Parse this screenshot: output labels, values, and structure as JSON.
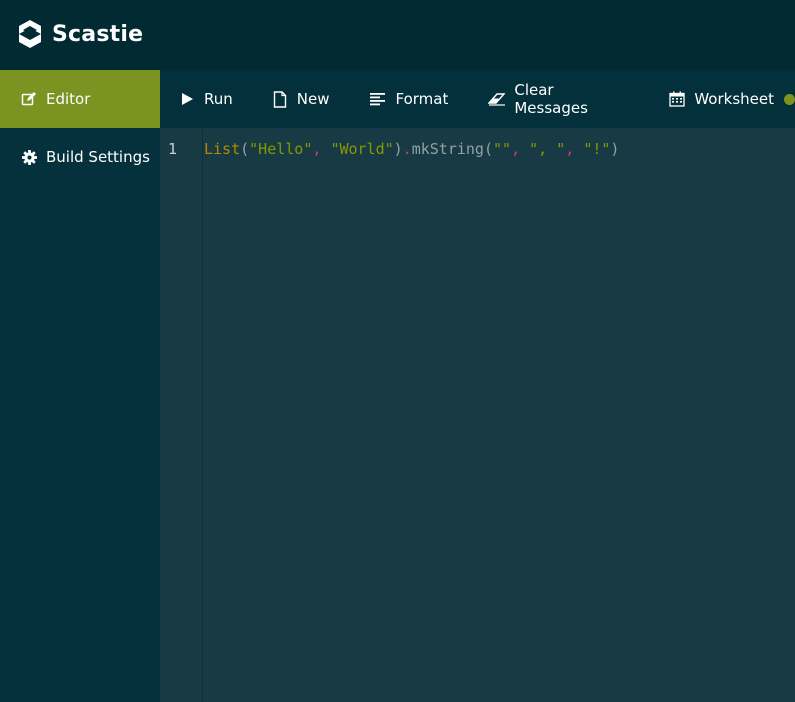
{
  "app": {
    "name": "Scastie"
  },
  "sidebar": {
    "items": [
      {
        "label": "Editor",
        "icon": "edit-icon",
        "active": true
      },
      {
        "label": "Build Settings",
        "icon": "gear-icon",
        "active": false
      }
    ]
  },
  "toolbar": {
    "run_label": "Run",
    "new_label": "New",
    "format_label": "Format",
    "clear_label": "Clear Messages",
    "worksheet_label": "Worksheet",
    "worksheet_status_color": "#7b9320"
  },
  "editor": {
    "line_number": "1",
    "tokens": {
      "t1": "List",
      "t2": "(",
      "t3": "\"Hello\"",
      "t4": ",",
      "t5": " ",
      "t6": "\"World\"",
      "t7": ")",
      "t8": ".",
      "t9": "mkString",
      "t10": "(",
      "t11": "\"\"",
      "t12": ",",
      "t13": " ",
      "t14": "\", \"",
      "t15": ",",
      "t16": " ",
      "t17": "\"!\"",
      "t18": ")"
    }
  },
  "colors": {
    "accent": "#7b9320",
    "topbar": "#012a33",
    "sidebar": "#05313c",
    "editor_bg": "#183a45"
  }
}
